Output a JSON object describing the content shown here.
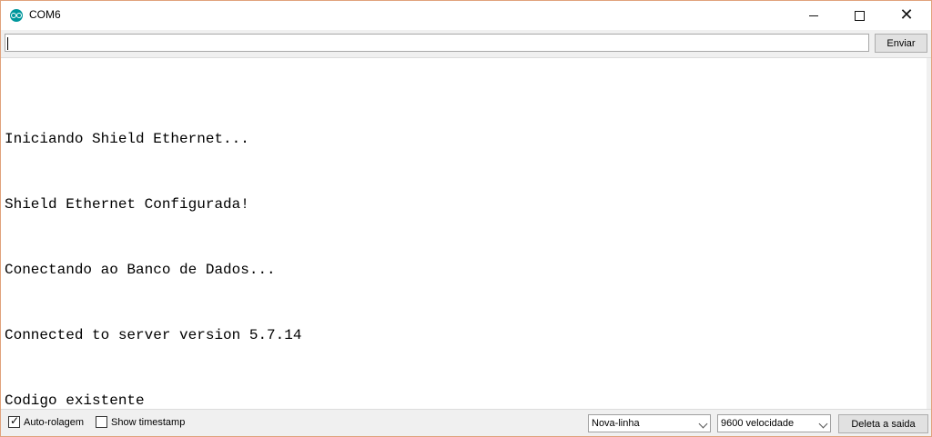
{
  "window": {
    "title": "COM6",
    "app_icon": "arduino-icon"
  },
  "send": {
    "input_value": "",
    "button_label": "Enviar"
  },
  "log": {
    "lines": [
      "Iniciando Shield Ethernet...",
      "Shield Ethernet Configurada!",
      "Conectando ao Banco de Dados...",
      "Connected to server version 5.7.14",
      "Codigo existente"
    ]
  },
  "footer": {
    "autoscroll": {
      "label": "Auto-rolagem",
      "checked": true
    },
    "timestamp": {
      "label": "Show timestamp",
      "checked": false
    },
    "line_ending": "Nova-linha",
    "baud_rate": "9600 velocidade",
    "clear_button": "Deleta a saida"
  },
  "colors": {
    "accent": "#00979c",
    "window_border": "#e0a27c",
    "bar_background": "#f0f0f0"
  }
}
